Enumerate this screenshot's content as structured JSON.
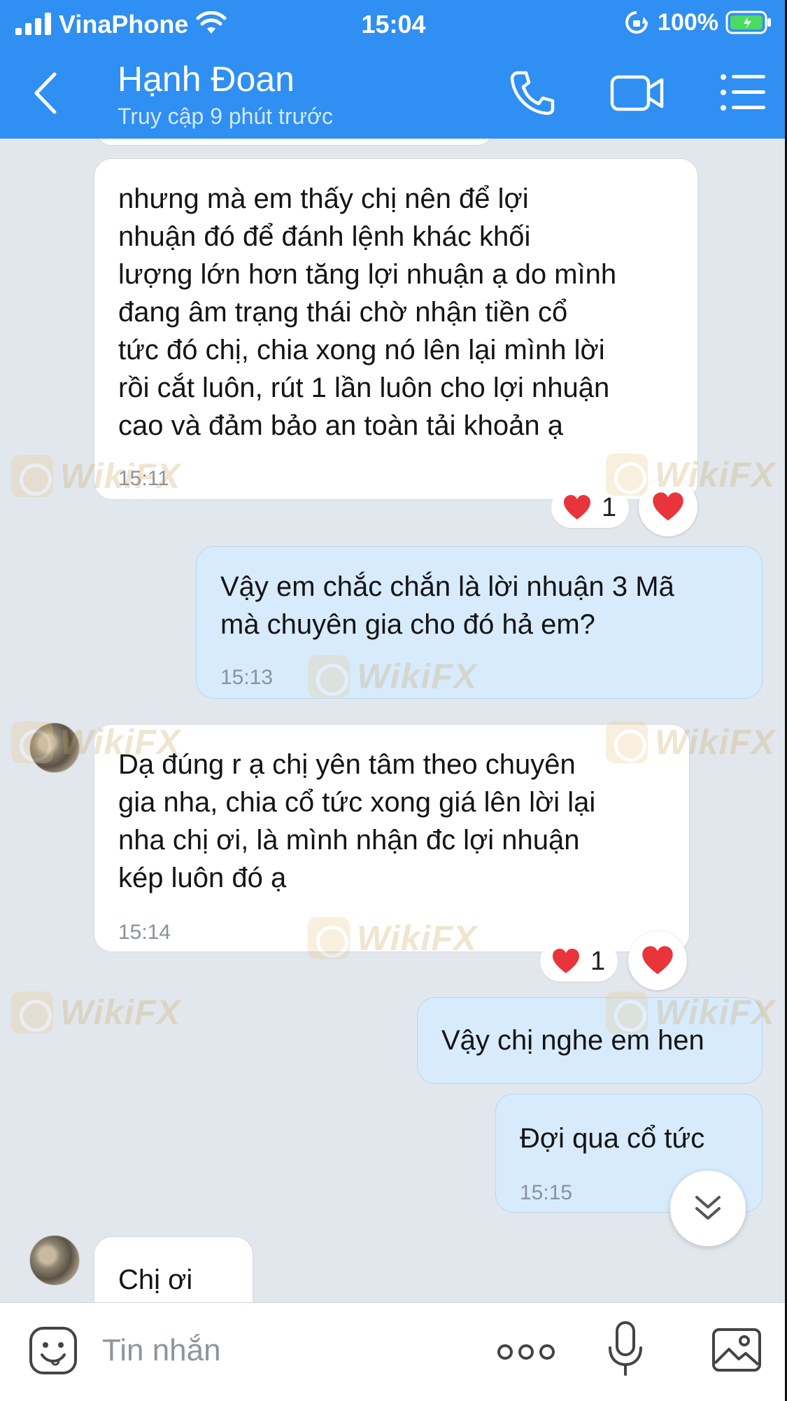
{
  "status_bar": {
    "carrier": "VinaPhone",
    "time": "15:04",
    "battery": "100%"
  },
  "header": {
    "contact_name": "Hạnh Đoan",
    "last_seen": "Truy cập 9 phút trước",
    "accent_color": "#2f8ff2"
  },
  "messages": [
    {
      "direction": "in",
      "text": "nhưng mà em thấy chị nên để lợi\nnhuận đó để đánh lệnh khác khối\nlượng lớn hơn tăng lợi nhuận ạ do mình\nđang âm trạng thái chờ nhận tiền cổ\ntức đó chị, chia xong nó lên lại mình lời\nrồi cắt luôn, rút 1 lần luôn cho lợi nhuận\ncao và đảm bảo an toàn tải khoản ạ",
      "time": "15:11",
      "reaction_count": "1"
    },
    {
      "direction": "out",
      "text": "Vậy em chắc chắn là lời nhuận 3 Mã\nmà chuyên gia cho đó hả em?",
      "time": "15:13"
    },
    {
      "direction": "in",
      "text": "Dạ đúng r ạ chị yên tâm theo chuyên\ngia nha, chia cổ tức xong giá lên lời lại\nnha chị ơi, là mình nhận đc lợi nhuận\nkép luôn đó ạ",
      "time": "15:14",
      "reaction_count": "1"
    },
    {
      "direction": "out",
      "text": "Vậy chị nghe em hen",
      "time": ""
    },
    {
      "direction": "out",
      "text": "Đợi qua cổ tức",
      "time": "15:15"
    },
    {
      "direction": "in",
      "text": "Chị ơi",
      "time": ""
    }
  ],
  "watermark": "WikiFX",
  "input": {
    "placeholder": "Tin nhắn"
  },
  "icons": {
    "back": "chevron-left-icon",
    "call": "phone-icon",
    "video": "video-camera-icon",
    "menu": "list-menu-icon",
    "emoji": "emoji-sticker-icon",
    "more": "more-dots-icon",
    "mic": "microphone-icon",
    "image": "image-icon",
    "reaction": "heart-icon",
    "scroll": "double-chevron-down-icon"
  }
}
